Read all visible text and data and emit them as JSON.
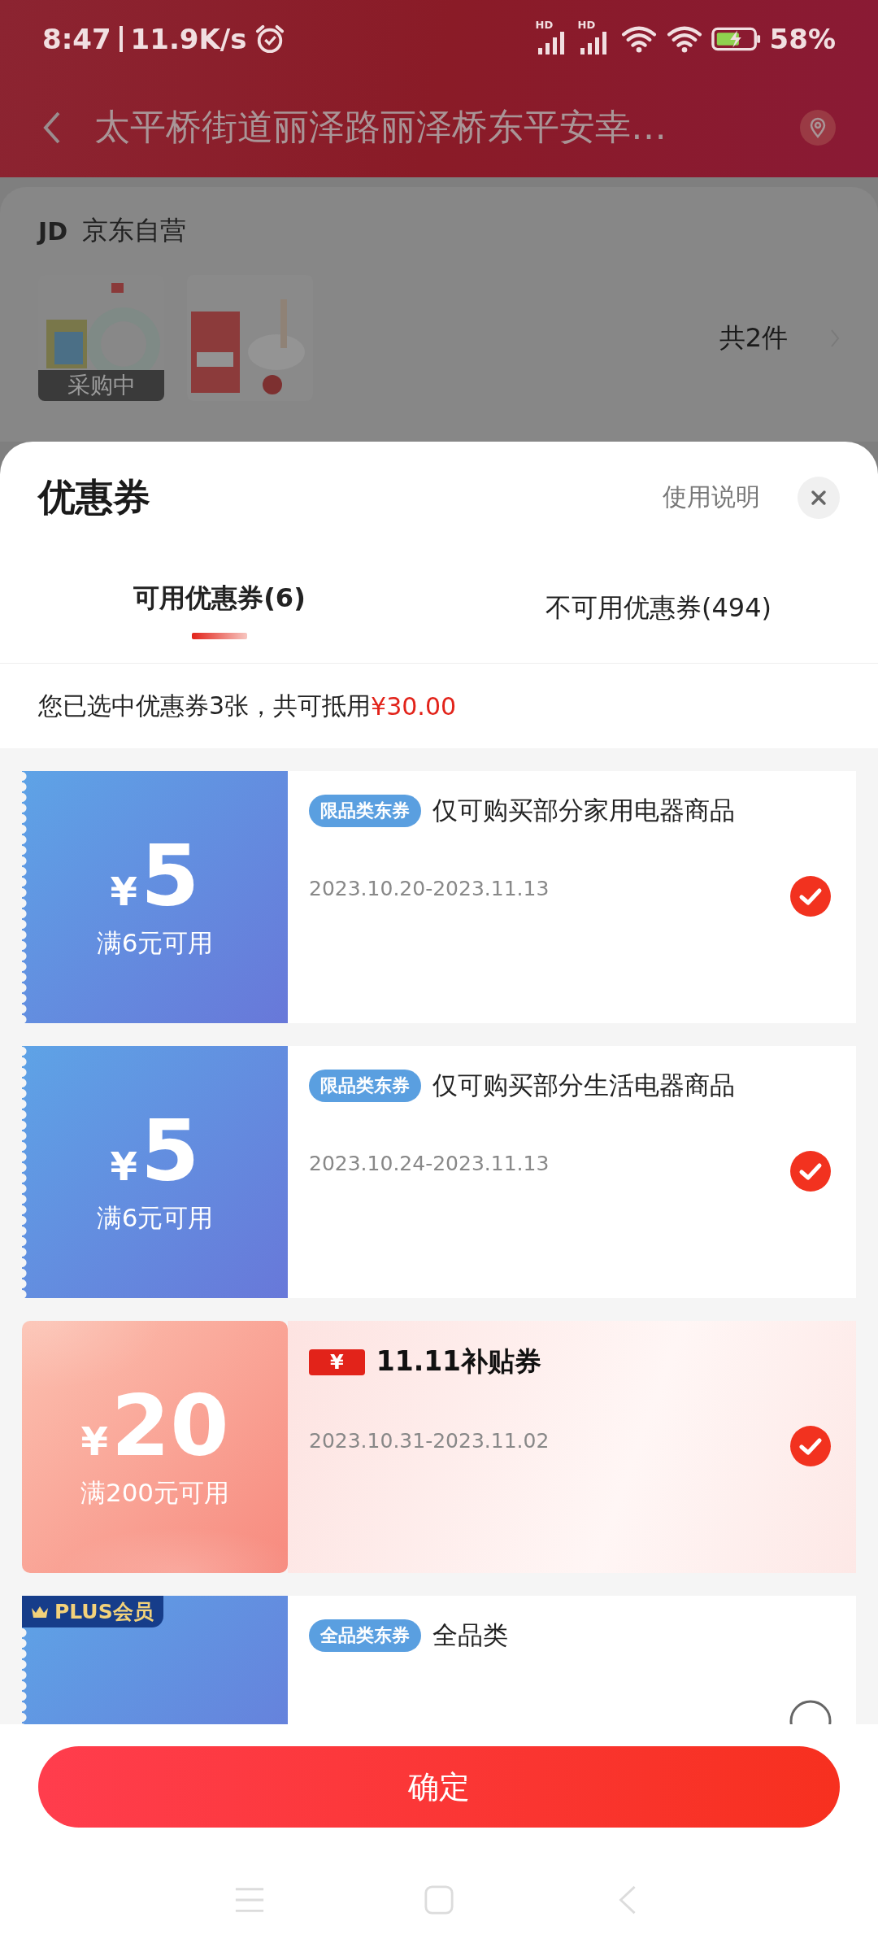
{
  "status_bar": {
    "time": "8:47",
    "speed": "11.9K/s",
    "sim_labels": [
      "HD",
      "HD"
    ],
    "battery": "58%"
  },
  "header": {
    "address": "太平桥街道丽泽路丽泽桥东平安幸…"
  },
  "store": {
    "logo": "JD",
    "name": "京东自营",
    "count": "共2件",
    "products": [
      {
        "kind": "picture",
        "overlay": "采购中"
      },
      {
        "kind": "picture"
      }
    ]
  },
  "sheet": {
    "title": "优惠券",
    "help_link": "使用说明"
  },
  "tabs": [
    {
      "label": "可用优惠券(6)",
      "selected": true
    },
    {
      "label": "不可用优惠券(494)",
      "selected": false
    }
  ],
  "summary": {
    "text": "您已选中优惠券3张，共可抵用",
    "amount": "¥30.00"
  },
  "coupons": [
    {
      "kind": "category",
      "currency": "¥",
      "amount": "5",
      "condition": "满6元可用",
      "tag": "限品类东券",
      "title": "仅可购买部分家用电器商品",
      "dates": "2023.10.20-2023.11.13",
      "selected": true
    },
    {
      "kind": "category",
      "currency": "¥",
      "amount": "5",
      "condition": "满6元可用",
      "tag": "限品类东券",
      "title": "仅可购买部分生活电器商品",
      "dates": "2023.10.24-2023.11.13",
      "selected": true
    },
    {
      "kind": "subsidy",
      "currency": "¥",
      "amount": "20",
      "condition": "满200元可用",
      "badge": "¥",
      "title": "11.11补贴券",
      "dates": "2023.10.31-2023.11.02",
      "selected": true
    },
    {
      "kind": "category",
      "ribbon": "PLUS会员",
      "tag": "全品类东券",
      "title": "全品类",
      "selected": false
    }
  ],
  "confirm_button": "确定"
}
